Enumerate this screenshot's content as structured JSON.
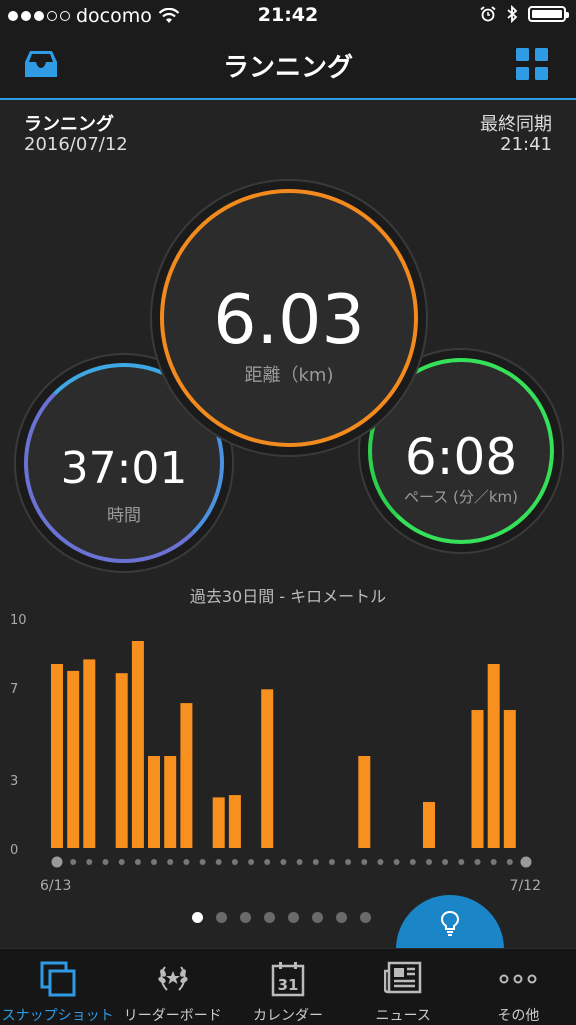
{
  "status_bar": {
    "carrier": "docomo",
    "time": "21:42"
  },
  "nav": {
    "title": "ランニング"
  },
  "activity": {
    "name": "ランニング",
    "date": "2016/07/12",
    "sync_label": "最終同期",
    "sync_time": "21:41"
  },
  "metrics": {
    "distance": {
      "value": "6.03",
      "label": "距離（km)"
    },
    "time": {
      "value": "37:01",
      "label": "時間"
    },
    "pace": {
      "value": "6:08",
      "label": "ペース (分／km)"
    }
  },
  "chart_title": "過去30日間 - キロメートル",
  "chart_data": {
    "type": "bar",
    "title": "過去30日間 - キロメートル",
    "y_ticks": [
      "10",
      "7",
      "3",
      "0"
    ],
    "ylim": [
      0,
      10
    ],
    "x_start_label": "6/13",
    "x_end_label": "7/12",
    "days": 30,
    "values": [
      8.0,
      7.7,
      8.2,
      0,
      7.6,
      9.0,
      4.0,
      4.0,
      6.3,
      0,
      2.2,
      2.3,
      0,
      6.9,
      0,
      0,
      0,
      0,
      0,
      4.0,
      0,
      0,
      0,
      2.0,
      0,
      0,
      6.0,
      8.0,
      6.0,
      0
    ],
    "bar_color": "#f7901e"
  },
  "pager": {
    "pages": 8,
    "active": 0
  },
  "colors": {
    "accent": "#2f9be5",
    "distance_ring": "#f28a1e",
    "time_ring": "#6a73d4",
    "pace_ring": "#36e15a"
  },
  "tabs": [
    {
      "label": "スナップショット",
      "icon": "snapshot-icon",
      "active": true
    },
    {
      "label": "リーダーボード",
      "icon": "laurel-icon",
      "active": false
    },
    {
      "label": "カレンダー",
      "icon": "calendar-icon",
      "active": false,
      "icon_text": "31"
    },
    {
      "label": "ニュース",
      "icon": "news-icon",
      "active": false
    },
    {
      "label": "その他",
      "icon": "more-icon",
      "active": false
    }
  ]
}
